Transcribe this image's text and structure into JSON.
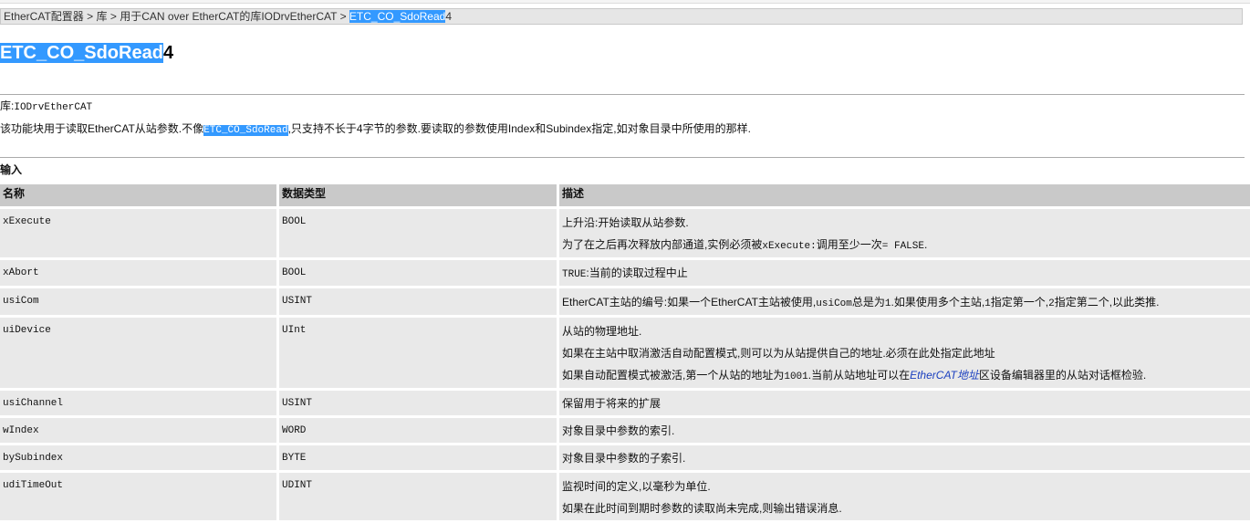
{
  "breadcrumb": {
    "crumb1": "EtherCAT配置器",
    "sep1": " > ",
    "crumb2": "库",
    "sep2": " > ",
    "crumb3": "用于CAN over EtherCAT的库IODrvEtherCAT",
    "sep3": " > ",
    "current_selected": "ETC_CO_SdoRead",
    "current_rest": "4"
  },
  "title": {
    "selected": "ETC_CO_SdoRead",
    "rest": "4"
  },
  "library": {
    "label": "库:",
    "value": "IODrvEtherCAT"
  },
  "description": {
    "part1": "该功能块用于读取EtherCAT从站参数.不像",
    "highlight": "ETC_CO_SdoRead",
    "part2": ",只支持不长于4字节的参数.要读取的参数使用Index和Subindex指定,如对象目录中所使用的那样."
  },
  "inputs_section": "输入",
  "table": {
    "headers": {
      "name": "名称",
      "type": "数据类型",
      "desc": "描述"
    },
    "rows": [
      {
        "name": "xExecute",
        "type": "BOOL",
        "d1": "上升沿:开始读取从站参数.",
        "d2a": "为了在之后再次释放内部通道,实例必须被",
        "d2code": "xExecute:",
        "d2b": "调用至少一次",
        "d2code2": "= FALSE",
        "d2c": "."
      },
      {
        "name": "xAbort",
        "type": "BOOL",
        "d1code": "TRUE",
        "d1": ":当前的读取过程中止"
      },
      {
        "name": "usiCom",
        "type": "USINT",
        "d1a": "EtherCAT主站的编号:如果一个EtherCAT主站被使用,",
        "d1code": "usiCom",
        "d1b": "总是为",
        "d1code2": "1",
        "d1c": ".如果使用多个主站,",
        "d1code3": "1",
        "d1d": "指定第一个,",
        "d1code4": "2",
        "d1e": "指定第二个,以此类推."
      },
      {
        "name": "uiDevice",
        "type": "UInt",
        "d1": "从站的物理地址.",
        "d2": "如果在主站中取消激活自动配置模式,则可以为从站提供自己的地址.必须在此处指定此地址",
        "d3a": "如果自动配置模式被激活,第一个从站的地址为",
        "d3code": "1001",
        "d3b": ".当前从站地址可以在",
        "d3link": "EtherCAT地址",
        "d3c": "区设备编辑器里的从站对话框检验."
      },
      {
        "name": "usiChannel",
        "type": "USINT",
        "d1": "保留用于将来的扩展"
      },
      {
        "name": "wIndex",
        "type": "WORD",
        "d1": "对象目录中参数的索引."
      },
      {
        "name": "bySubindex",
        "type": "BYTE",
        "d1": "对象目录中参数的子索引."
      },
      {
        "name": "udiTimeOut",
        "type": "UDINT",
        "d1": "监视时间的定义,以毫秒为单位.",
        "d2": "如果在此时间到期时参数的读取尚未完成,则输出错误消息."
      }
    ]
  }
}
